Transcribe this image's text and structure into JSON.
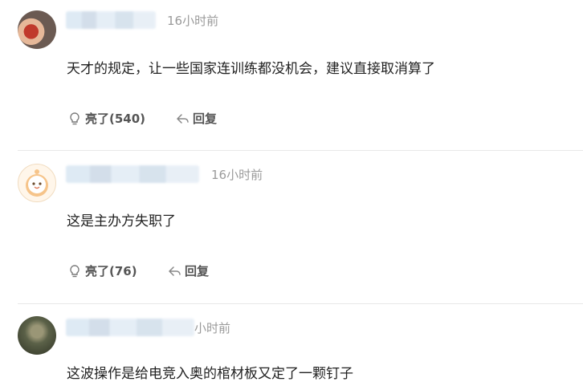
{
  "comments": [
    {
      "time": "16小时前",
      "text": "天才的规定，让一些国家连训练都没机会，建议直接取消算了",
      "like_label": "亮了",
      "like_count": "(540)",
      "reply_label": "回复"
    },
    {
      "time": "16小时前",
      "text": "这是主办方失职了",
      "like_label": "亮了",
      "like_count": "(76)",
      "reply_label": "回复"
    },
    {
      "time": "小时前",
      "text": "这波操作是给电竞入奥的棺材板又定了一颗钉子"
    }
  ]
}
